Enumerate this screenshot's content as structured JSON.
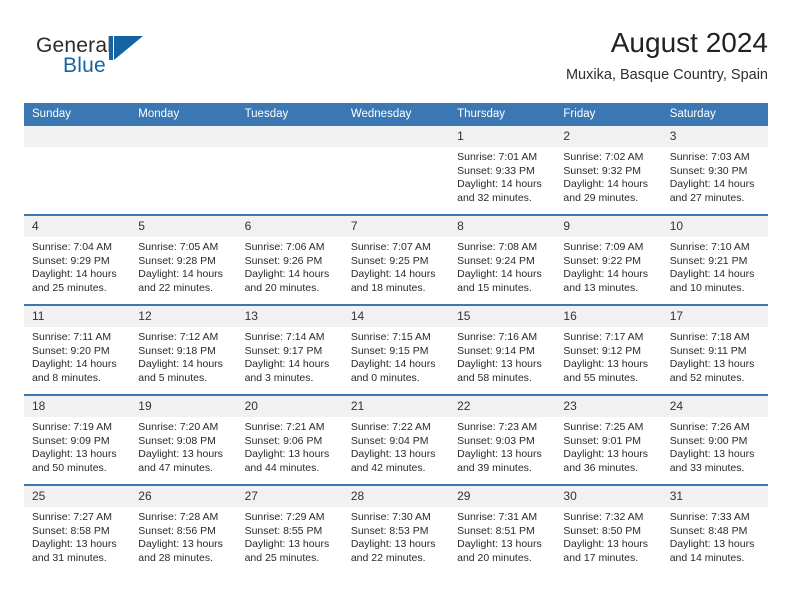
{
  "brand": {
    "word_one": "General",
    "word_two": "Blue",
    "mark": "triangle-logo",
    "accent_color": "#1464a5"
  },
  "header": {
    "title": "August 2024",
    "subtitle": "Muxika, Basque Country, Spain"
  },
  "colors": {
    "header_blue": "#3b77b3",
    "daynum_band": "#f1f1f1",
    "text": "#2a2a2a"
  },
  "weekday_headers": [
    "Sunday",
    "Monday",
    "Tuesday",
    "Wednesday",
    "Thursday",
    "Friday",
    "Saturday"
  ],
  "weeks": [
    [
      {
        "day": "",
        "empty": true
      },
      {
        "day": "",
        "empty": true
      },
      {
        "day": "",
        "empty": true
      },
      {
        "day": "",
        "empty": true
      },
      {
        "day": "1",
        "sunrise": "Sunrise: 7:01 AM",
        "sunset": "Sunset: 9:33 PM",
        "daylight_1": "Daylight: 14 hours",
        "daylight_2": "and 32 minutes."
      },
      {
        "day": "2",
        "sunrise": "Sunrise: 7:02 AM",
        "sunset": "Sunset: 9:32 PM",
        "daylight_1": "Daylight: 14 hours",
        "daylight_2": "and 29 minutes."
      },
      {
        "day": "3",
        "sunrise": "Sunrise: 7:03 AM",
        "sunset": "Sunset: 9:30 PM",
        "daylight_1": "Daylight: 14 hours",
        "daylight_2": "and 27 minutes."
      }
    ],
    [
      {
        "day": "4",
        "sunrise": "Sunrise: 7:04 AM",
        "sunset": "Sunset: 9:29 PM",
        "daylight_1": "Daylight: 14 hours",
        "daylight_2": "and 25 minutes."
      },
      {
        "day": "5",
        "sunrise": "Sunrise: 7:05 AM",
        "sunset": "Sunset: 9:28 PM",
        "daylight_1": "Daylight: 14 hours",
        "daylight_2": "and 22 minutes."
      },
      {
        "day": "6",
        "sunrise": "Sunrise: 7:06 AM",
        "sunset": "Sunset: 9:26 PM",
        "daylight_1": "Daylight: 14 hours",
        "daylight_2": "and 20 minutes."
      },
      {
        "day": "7",
        "sunrise": "Sunrise: 7:07 AM",
        "sunset": "Sunset: 9:25 PM",
        "daylight_1": "Daylight: 14 hours",
        "daylight_2": "and 18 minutes."
      },
      {
        "day": "8",
        "sunrise": "Sunrise: 7:08 AM",
        "sunset": "Sunset: 9:24 PM",
        "daylight_1": "Daylight: 14 hours",
        "daylight_2": "and 15 minutes."
      },
      {
        "day": "9",
        "sunrise": "Sunrise: 7:09 AM",
        "sunset": "Sunset: 9:22 PM",
        "daylight_1": "Daylight: 14 hours",
        "daylight_2": "and 13 minutes."
      },
      {
        "day": "10",
        "sunrise": "Sunrise: 7:10 AM",
        "sunset": "Sunset: 9:21 PM",
        "daylight_1": "Daylight: 14 hours",
        "daylight_2": "and 10 minutes."
      }
    ],
    [
      {
        "day": "11",
        "sunrise": "Sunrise: 7:11 AM",
        "sunset": "Sunset: 9:20 PM",
        "daylight_1": "Daylight: 14 hours",
        "daylight_2": "and 8 minutes."
      },
      {
        "day": "12",
        "sunrise": "Sunrise: 7:12 AM",
        "sunset": "Sunset: 9:18 PM",
        "daylight_1": "Daylight: 14 hours",
        "daylight_2": "and 5 minutes."
      },
      {
        "day": "13",
        "sunrise": "Sunrise: 7:14 AM",
        "sunset": "Sunset: 9:17 PM",
        "daylight_1": "Daylight: 14 hours",
        "daylight_2": "and 3 minutes."
      },
      {
        "day": "14",
        "sunrise": "Sunrise: 7:15 AM",
        "sunset": "Sunset: 9:15 PM",
        "daylight_1": "Daylight: 14 hours",
        "daylight_2": "and 0 minutes."
      },
      {
        "day": "15",
        "sunrise": "Sunrise: 7:16 AM",
        "sunset": "Sunset: 9:14 PM",
        "daylight_1": "Daylight: 13 hours",
        "daylight_2": "and 58 minutes."
      },
      {
        "day": "16",
        "sunrise": "Sunrise: 7:17 AM",
        "sunset": "Sunset: 9:12 PM",
        "daylight_1": "Daylight: 13 hours",
        "daylight_2": "and 55 minutes."
      },
      {
        "day": "17",
        "sunrise": "Sunrise: 7:18 AM",
        "sunset": "Sunset: 9:11 PM",
        "daylight_1": "Daylight: 13 hours",
        "daylight_2": "and 52 minutes."
      }
    ],
    [
      {
        "day": "18",
        "sunrise": "Sunrise: 7:19 AM",
        "sunset": "Sunset: 9:09 PM",
        "daylight_1": "Daylight: 13 hours",
        "daylight_2": "and 50 minutes."
      },
      {
        "day": "19",
        "sunrise": "Sunrise: 7:20 AM",
        "sunset": "Sunset: 9:08 PM",
        "daylight_1": "Daylight: 13 hours",
        "daylight_2": "and 47 minutes."
      },
      {
        "day": "20",
        "sunrise": "Sunrise: 7:21 AM",
        "sunset": "Sunset: 9:06 PM",
        "daylight_1": "Daylight: 13 hours",
        "daylight_2": "and 44 minutes."
      },
      {
        "day": "21",
        "sunrise": "Sunrise: 7:22 AM",
        "sunset": "Sunset: 9:04 PM",
        "daylight_1": "Daylight: 13 hours",
        "daylight_2": "and 42 minutes."
      },
      {
        "day": "22",
        "sunrise": "Sunrise: 7:23 AM",
        "sunset": "Sunset: 9:03 PM",
        "daylight_1": "Daylight: 13 hours",
        "daylight_2": "and 39 minutes."
      },
      {
        "day": "23",
        "sunrise": "Sunrise: 7:25 AM",
        "sunset": "Sunset: 9:01 PM",
        "daylight_1": "Daylight: 13 hours",
        "daylight_2": "and 36 minutes."
      },
      {
        "day": "24",
        "sunrise": "Sunrise: 7:26 AM",
        "sunset": "Sunset: 9:00 PM",
        "daylight_1": "Daylight: 13 hours",
        "daylight_2": "and 33 minutes."
      }
    ],
    [
      {
        "day": "25",
        "sunrise": "Sunrise: 7:27 AM",
        "sunset": "Sunset: 8:58 PM",
        "daylight_1": "Daylight: 13 hours",
        "daylight_2": "and 31 minutes."
      },
      {
        "day": "26",
        "sunrise": "Sunrise: 7:28 AM",
        "sunset": "Sunset: 8:56 PM",
        "daylight_1": "Daylight: 13 hours",
        "daylight_2": "and 28 minutes."
      },
      {
        "day": "27",
        "sunrise": "Sunrise: 7:29 AM",
        "sunset": "Sunset: 8:55 PM",
        "daylight_1": "Daylight: 13 hours",
        "daylight_2": "and 25 minutes."
      },
      {
        "day": "28",
        "sunrise": "Sunrise: 7:30 AM",
        "sunset": "Sunset: 8:53 PM",
        "daylight_1": "Daylight: 13 hours",
        "daylight_2": "and 22 minutes."
      },
      {
        "day": "29",
        "sunrise": "Sunrise: 7:31 AM",
        "sunset": "Sunset: 8:51 PM",
        "daylight_1": "Daylight: 13 hours",
        "daylight_2": "and 20 minutes."
      },
      {
        "day": "30",
        "sunrise": "Sunrise: 7:32 AM",
        "sunset": "Sunset: 8:50 PM",
        "daylight_1": "Daylight: 13 hours",
        "daylight_2": "and 17 minutes."
      },
      {
        "day": "31",
        "sunrise": "Sunrise: 7:33 AM",
        "sunset": "Sunset: 8:48 PM",
        "daylight_1": "Daylight: 13 hours",
        "daylight_2": "and 14 minutes."
      }
    ]
  ]
}
